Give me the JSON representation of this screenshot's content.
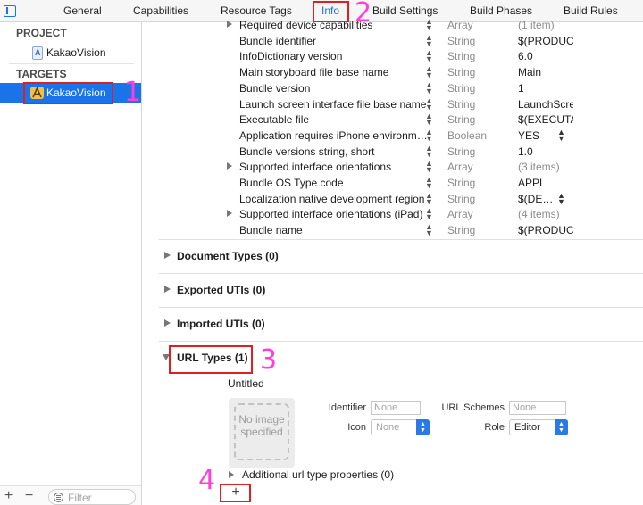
{
  "tabs": [
    "General",
    "Capabilities",
    "Resource Tags",
    "Info",
    "Build Settings",
    "Build Phases",
    "Build Rules"
  ],
  "sidebar": {
    "project_header": "PROJECT",
    "project_name": "KakaoVision",
    "targets_header": "TARGETS",
    "target_name": "KakaoVision",
    "filter_placeholder": "Filter",
    "add_symbol": "+",
    "remove_symbol": "−"
  },
  "plist_rows": [
    {
      "key": "Required device capabilities",
      "type": "Array",
      "value": "(1 item)",
      "disclosure": true,
      "muted_value": true
    },
    {
      "key": "Bundle identifier",
      "type": "String",
      "value": "$(PRODUCT_BUNDLE_IDENTIFIER)"
    },
    {
      "key": "InfoDictionary version",
      "type": "String",
      "value": "6.0"
    },
    {
      "key": "Main storyboard file base name",
      "type": "String",
      "value": "Main"
    },
    {
      "key": "Bundle version",
      "type": "String",
      "value": "1"
    },
    {
      "key": "Launch screen interface file base name",
      "type": "String",
      "value": "LaunchScreen"
    },
    {
      "key": "Executable file",
      "type": "String",
      "value": "$(EXECUTABLE_NAME)"
    },
    {
      "key": "Application requires iPhone environm…",
      "type": "Boolean",
      "value": "YES",
      "value_stepper": true
    },
    {
      "key": "Bundle versions string, short",
      "type": "String",
      "value": "1.0"
    },
    {
      "key": "Supported interface orientations",
      "type": "Array",
      "value": "(3 items)",
      "disclosure": true,
      "muted_value": true
    },
    {
      "key": "Bundle OS Type code",
      "type": "String",
      "value": "APPL"
    },
    {
      "key": "Localization native development region",
      "type": "String",
      "value": "$(DE…",
      "value_stepper": true
    },
    {
      "key": "Supported interface orientations (iPad)",
      "type": "Array",
      "value": "(4 items)",
      "disclosure": true,
      "muted_value": true
    },
    {
      "key": "Bundle name",
      "type": "String",
      "value": "$(PRODUCT_NAME)"
    }
  ],
  "sections": {
    "document_types": "Document Types (0)",
    "exported_utis": "Exported UTIs (0)",
    "imported_utis": "Imported UTIs (0)",
    "url_types": "URL Types (1)"
  },
  "url_type": {
    "title": "Untitled",
    "image_placeholder": "No image specified",
    "identifier_label": "Identifier",
    "identifier_placeholder": "None",
    "icon_label": "Icon",
    "icon_value": "None",
    "url_schemes_label": "URL Schemes",
    "url_schemes_placeholder": "None",
    "role_label": "Role",
    "role_value": "Editor",
    "additional_properties": "Additional url type properties (0)",
    "add_symbol": "+"
  },
  "annotations": [
    "1",
    "2",
    "3",
    "4"
  ],
  "colors": {
    "accent": "#1a73e8",
    "annotation_box": "#e02020",
    "annotation_number": "#ff3fd7"
  }
}
